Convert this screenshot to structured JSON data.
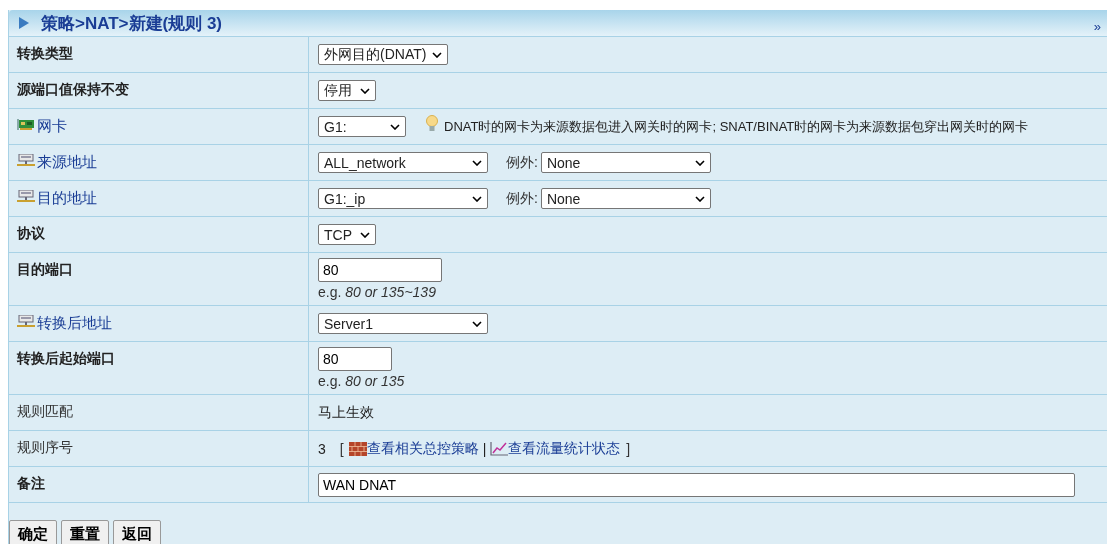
{
  "title": "策略>NAT>新建(规则 3)",
  "collapse": "»",
  "rows": [
    {
      "kind": "setting",
      "label": "转换类型",
      "value": {
        "kind": "select",
        "value": "外网目的(DNAT)"
      }
    },
    {
      "kind": "setting",
      "label": "源端口值保持不变",
      "value": {
        "kind": "select",
        "value": "停用"
      }
    },
    {
      "kind": "interface",
      "label": "网卡",
      "value": {
        "kind": "select",
        "value": "G1:",
        "tip": "DNAT时的网卡为来源数据包进入网关时的网卡; SNAT/BINAT时的网卡为来源数据包穿出网关时的网卡"
      }
    },
    {
      "kind": "address",
      "label": "来源地址",
      "value": {
        "kind": "select",
        "value": "ALL_network",
        "exception_label": "例外:",
        "exception_value": "None"
      }
    },
    {
      "kind": "address",
      "label": "目的地址",
      "value": {
        "kind": "select",
        "value": "G1:_ip",
        "exception_label": "例外:",
        "exception_value": "None"
      }
    },
    {
      "kind": "setting",
      "label": "协议",
      "value": {
        "kind": "select",
        "value": "TCP"
      }
    },
    {
      "kind": "setting",
      "label": "目的端口",
      "value": {
        "kind": "input",
        "value": "80",
        "hint": "e.g. *80 or 135~139*"
      }
    },
    {
      "kind": "address",
      "label": "转换后地址",
      "value": {
        "kind": "select",
        "value": "Server1"
      }
    },
    {
      "kind": "setting",
      "label": "转换后起始端口",
      "value": {
        "kind": "input",
        "value": "80",
        "hint": "e.g. *80 or 135*"
      }
    },
    {
      "kind": "info",
      "label": "规则匹配",
      "value": {
        "kind": "text",
        "value": "马上生效"
      }
    },
    {
      "kind": "info",
      "label": "规则序号",
      "value": {
        "kind": "rule_no",
        "value": "3",
        "open": "[",
        "sep": "|",
        "close": "]",
        "links": [
          "查看相关总控策略",
          "查看流量统计状态"
        ]
      }
    },
    {
      "kind": "setting",
      "label": "备注",
      "value": {
        "kind": "input",
        "value": "WAN DNAT"
      }
    }
  ],
  "buttons": [
    "确定",
    "重置",
    "返回"
  ]
}
